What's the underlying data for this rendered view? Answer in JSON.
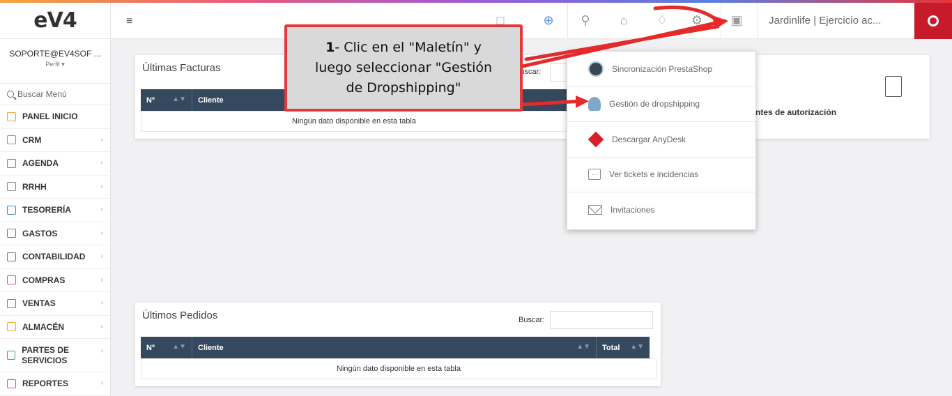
{
  "app": {
    "logo": "eV4",
    "company_label": "Jardinlife | Ejercicio ac..."
  },
  "user": {
    "email": "SOPORTE@EV4SOF ...",
    "perfil": "Perfil ▾"
  },
  "sidebar": {
    "search_placeholder": "Buscar Menú",
    "items": [
      {
        "label": "PANEL INICIO",
        "icon": "home-icon",
        "color": "#f0a030",
        "has_arrow": false
      },
      {
        "label": "CRM",
        "icon": "crm-icon",
        "color": "#5aa0d8",
        "has_arrow": true
      },
      {
        "label": "AGENDA",
        "icon": "calendar-icon",
        "color": "#e85555",
        "has_arrow": true
      },
      {
        "label": "RRHH",
        "icon": "rrhh-icon",
        "color": "#888888",
        "has_arrow": true
      },
      {
        "label": "TESORERÍA",
        "icon": "treasury-icon",
        "color": "#3b8ad0",
        "has_arrow": true
      },
      {
        "label": "GASTOS",
        "icon": "cube-icon",
        "color": "#777777",
        "has_arrow": true
      },
      {
        "label": "CONTABILIDAD",
        "icon": "save-icon",
        "color": "#777777",
        "has_arrow": true
      },
      {
        "label": "COMPRAS",
        "icon": "purchases-icon",
        "color": "#e85555",
        "has_arrow": true
      },
      {
        "label": "VENTAS",
        "icon": "sales-icon",
        "color": "#3aa55a",
        "has_arrow": true
      },
      {
        "label": "ALMACÉN",
        "icon": "warehouse-icon",
        "color": "#f0a030",
        "has_arrow": true
      },
      {
        "label": "PARTES DE SERVICIOS",
        "icon": "columns-icon",
        "color": "#3aa55a",
        "has_arrow": true
      },
      {
        "label": "REPORTES",
        "icon": "speaker-icon",
        "color": "#e85555",
        "has_arrow": true
      }
    ]
  },
  "panels": {
    "facturas": {
      "title": "Últimas Facturas",
      "buscar": "Buscar:",
      "col_num": "Nº",
      "col_cliente": "Cliente",
      "empty": "Ningún dato disponible en esta tabla"
    },
    "pedidos": {
      "title": "Últimos Pedidos",
      "buscar": "Buscar:",
      "col_num": "Nº",
      "col_cliente": "Cliente",
      "col_total": "Total",
      "empty": "Ningún dato disponible en esta tabla"
    },
    "autorizacion": {
      "text": "ntes de autorización"
    }
  },
  "dropdown": {
    "items": [
      {
        "label": "Sincronización PrestaShop",
        "icon": "prestashop-icon"
      },
      {
        "label": "Gestión de dropshipping",
        "icon": "dropshipping-icon"
      },
      {
        "label": "Descargar AnyDesk",
        "icon": "anydesk-icon"
      },
      {
        "label": "Ver tickets e incidencias",
        "icon": "ticket-icon"
      },
      {
        "label": "Invitaciones",
        "icon": "mail-icon"
      }
    ]
  },
  "callout": {
    "number": "1",
    "text_line1": "- Clic en el \"Maletín\" y",
    "text_line2": "luego seleccionar \"Gestión",
    "text_line3": "de Dropshipping\""
  },
  "colors": {
    "header_table": "#35485d",
    "callout_border": "#e23a3a",
    "lifebuoy": "#c71b2c"
  }
}
